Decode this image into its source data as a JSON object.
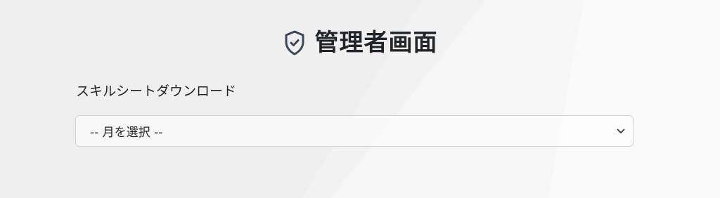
{
  "header": {
    "title": "管理者画面",
    "icon": "shield-check-icon"
  },
  "download": {
    "label": "スキルシートダウンロード",
    "month_select": {
      "selected": "-- 月を選択 --",
      "icon": "chevron-down-icon"
    }
  },
  "colors": {
    "background": "#f4f4f5",
    "icon": "#3c4656",
    "border": "#ced4da",
    "text": "#212529"
  }
}
